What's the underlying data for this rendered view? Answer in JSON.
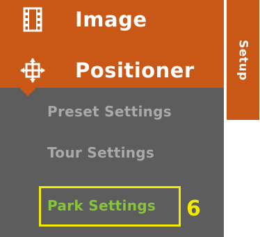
{
  "menu": {
    "image": {
      "label": "Image",
      "icon": "film-icon"
    },
    "positioner": {
      "label": "Positioner",
      "icon": "positioner-crosshair-icon"
    },
    "subitems": [
      {
        "label": "Preset Settings"
      },
      {
        "label": "Tour Settings"
      },
      {
        "label": "Park Settings"
      }
    ]
  },
  "tab": {
    "label": "Setup"
  },
  "annotation": {
    "number": "6"
  },
  "colors": {
    "accent": "#c95715",
    "menu_background": "#5d5d5d",
    "subitem_text": "#a9a9a9",
    "active_subitem_text": "#86c43a",
    "highlight": "#f4e900"
  }
}
